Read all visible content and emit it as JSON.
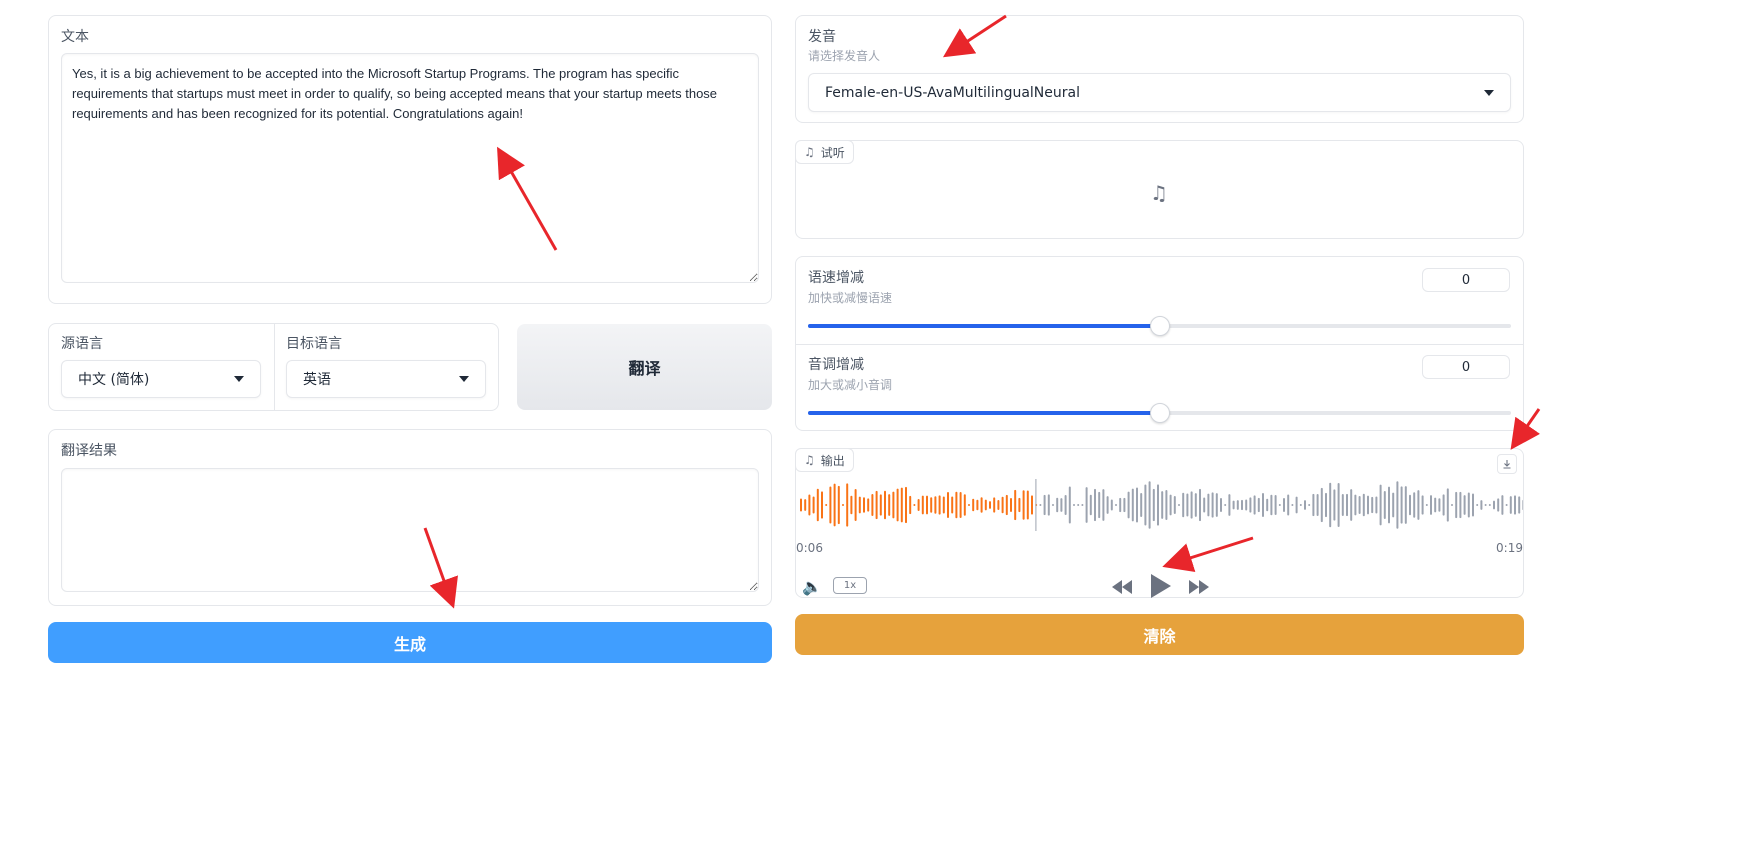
{
  "text_panel": {
    "label": "文本",
    "value": "Yes, it is a big achievement to be accepted into the Microsoft Startup Programs. The program has specific requirements that startups must meet in order to qualify, so being accepted means that your startup meets those requirements and has been recognized for its potential. Congratulations again!"
  },
  "source_lang": {
    "label": "源语言",
    "value": "中文 (简体)"
  },
  "target_lang": {
    "label": "目标语言",
    "value": "英语"
  },
  "translate_button": {
    "label": "翻译"
  },
  "translation_result": {
    "label": "翻译结果",
    "value": ""
  },
  "generate_button": {
    "label": "生成"
  },
  "voice": {
    "label": "发音",
    "info": "请选择发音人",
    "value": "Female-en-US-AvaMultilingualNeural"
  },
  "preview_audio": {
    "label": "试听"
  },
  "speed": {
    "label": "语速增减",
    "info": "加快或减慢语速",
    "value": "0",
    "level": 0.5
  },
  "pitch": {
    "label": "音调增减",
    "info": "加大或减小音调",
    "value": "0",
    "level": 0.5
  },
  "output_audio": {
    "label": "输出",
    "current_time": "0:06",
    "duration": "0:19",
    "playback_rate": "1x",
    "progress": 0.33,
    "played_color": "#f97316",
    "unplayed_color": "#9ca3af"
  },
  "clear_button": {
    "label": "清除"
  },
  "colors": {
    "generate": "#409eff",
    "clear": "#e6a23c",
    "translate_bg": "#e5e7eb",
    "slider": "#2563eb",
    "annotation": "#e8262b"
  }
}
